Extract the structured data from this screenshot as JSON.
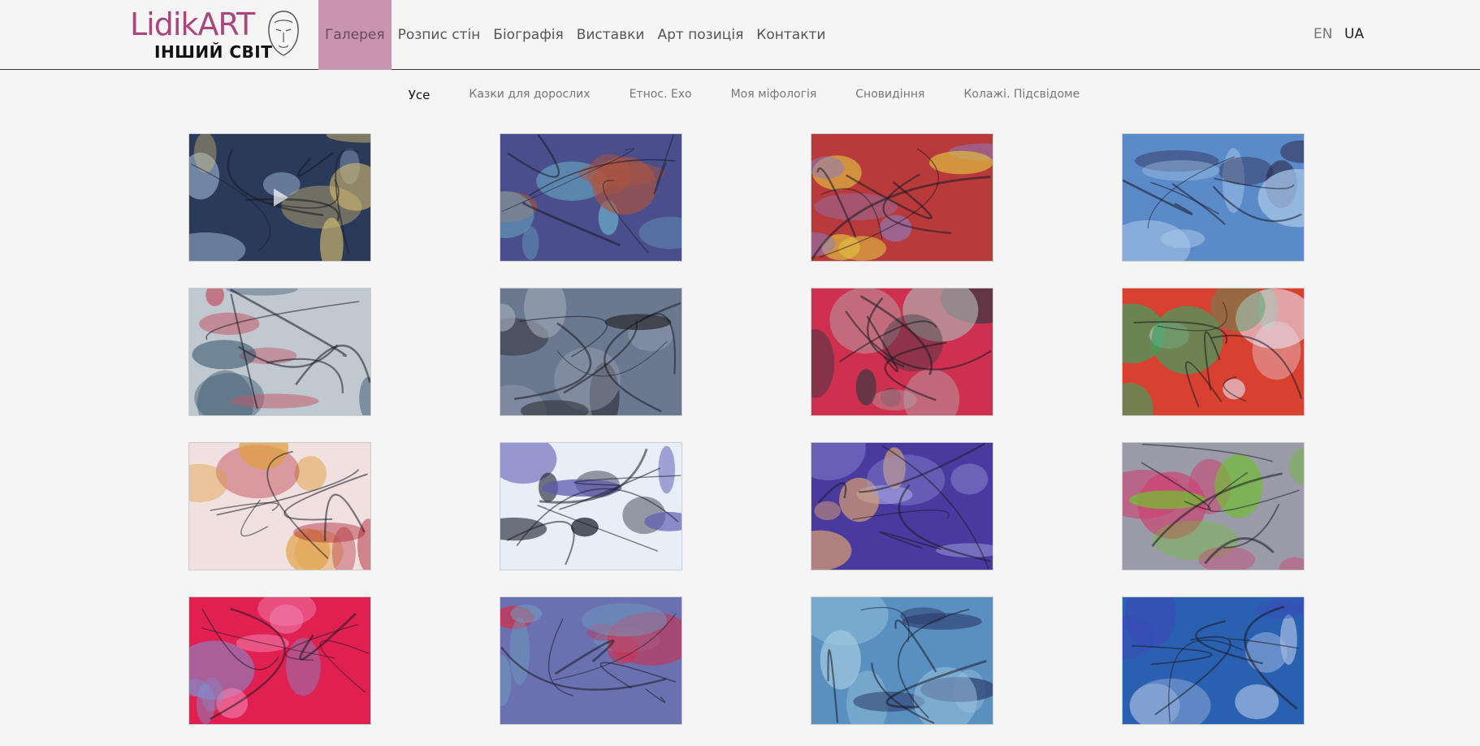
{
  "logo": {
    "main": "LidikART",
    "sub": "ІНШИЙ СВІТ"
  },
  "nav": [
    {
      "label": "Галерея",
      "active": true
    },
    {
      "label": "Розпис стін"
    },
    {
      "label": "Біографія"
    },
    {
      "label": "Виставки"
    },
    {
      "label": "Арт позиція"
    },
    {
      "label": "Контакти"
    }
  ],
  "lang": {
    "en": "EN",
    "ua": "UA"
  },
  "filters": [
    {
      "label": "Усе",
      "active": true
    },
    {
      "label": "Казки для дорослих"
    },
    {
      "label": "Етнос. Ехо"
    },
    {
      "label": "Моя міфологія"
    },
    {
      "label": "Сновидіння"
    },
    {
      "label": "Колажі. Підсвідоме"
    }
  ],
  "colors": {
    "accent": "#a8477c",
    "nav_active_bg": "#c894ae",
    "background": "#f5f5f5"
  },
  "tiles": [
    {
      "palette": [
        "#2c3a5a",
        "#8a9fc0",
        "#d8c070"
      ],
      "video": true
    },
    {
      "palette": [
        "#4a4e8c",
        "#b0543c",
        "#6ab0c8"
      ]
    },
    {
      "palette": [
        "#b83a3a",
        "#e0c040",
        "#8c7cc0"
      ]
    },
    {
      "palette": [
        "#5a8ac8",
        "#2a2040",
        "#a8c8e8"
      ]
    },
    {
      "palette": [
        "#c0c8d0",
        "#c05868",
        "#3a5870"
      ]
    },
    {
      "palette": [
        "#6a7890",
        "#2a2a30",
        "#a0a8b8"
      ]
    },
    {
      "palette": [
        "#d03050",
        "#b0b0b0",
        "#303840"
      ]
    },
    {
      "palette": [
        "#d84030",
        "#e8e0f0",
        "#40a060"
      ]
    },
    {
      "palette": [
        "#f0e0e0",
        "#b02030",
        "#e0a040"
      ]
    },
    {
      "palette": [
        "#e8eef8",
        "#5a5ab0",
        "#202030"
      ]
    },
    {
      "palette": [
        "#4a3aa0",
        "#d8a070",
        "#9898d8"
      ]
    },
    {
      "palette": [
        "#9a9aa8",
        "#70c030",
        "#d04070"
      ]
    },
    {
      "palette": [
        "#e02050",
        "#f080b0",
        "#8090d0"
      ]
    },
    {
      "palette": [
        "#6a70b0",
        "#d03050",
        "#70a0c0"
      ]
    },
    {
      "palette": [
        "#5a90c0",
        "#2a3a6a",
        "#a0c8e0"
      ]
    },
    {
      "palette": [
        "#2a60b0",
        "#3a4ab8",
        "#a0b8e0"
      ]
    }
  ]
}
